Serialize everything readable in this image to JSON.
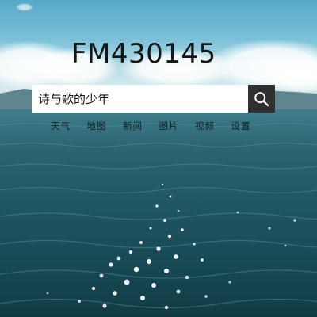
{
  "brand": {
    "title": "FM430145"
  },
  "search": {
    "value": "诗与歌的少年",
    "button_icon": "search-icon"
  },
  "nav": {
    "links": [
      "天气",
      "地图",
      "新闻",
      "图片",
      "视频",
      "设置"
    ]
  },
  "background": {
    "description_icon": "sea-sky-background",
    "sky_color": "#7cc0d8",
    "sea_color": "#1f5763"
  }
}
